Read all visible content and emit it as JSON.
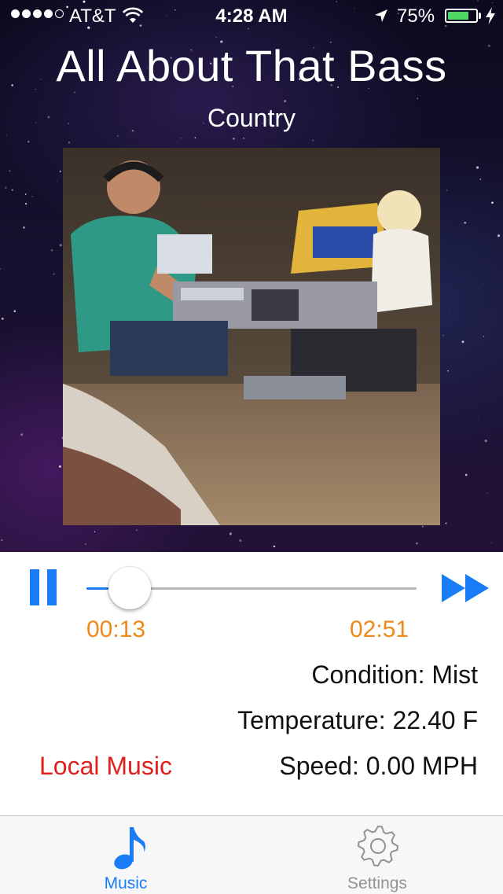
{
  "status_bar": {
    "carrier": "AT&T",
    "time": "4:28 AM",
    "battery_percent": "75%",
    "battery_level": 0.75,
    "signal_bars_filled": 4,
    "signal_bars_total": 5
  },
  "now_playing": {
    "title": "All About That Bass",
    "genre": "Country",
    "album_art": "studio-photo"
  },
  "player": {
    "elapsed": "00:13",
    "total": "02:51",
    "progress": 0.08,
    "pause_icon": "pause-icon",
    "forward_icon": "fast-forward-icon"
  },
  "info": {
    "condition": "Condition: Mist",
    "temperature": "Temperature: 22.40 F",
    "speed": "Speed: 0.00 MPH"
  },
  "local_music_label": "Local Music",
  "tabs": [
    {
      "label": "Music",
      "icon": "music-note-icon",
      "selected": true
    },
    {
      "label": "Settings",
      "icon": "gear-icon",
      "selected": false
    }
  ],
  "colors": {
    "accent": "#1a7cf6",
    "time_text": "#f0891c",
    "local_music": "#e0201e",
    "battery": "#4cd964"
  }
}
